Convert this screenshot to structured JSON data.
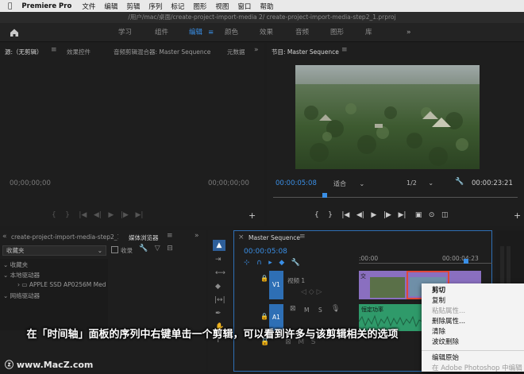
{
  "menubar": {
    "app": "Premiere Pro",
    "items": [
      "文件",
      "编辑",
      "剪辑",
      "序列",
      "标记",
      "图形",
      "视图",
      "窗口",
      "帮助"
    ]
  },
  "window_title": "/用户/mac/桌面/create-project-import-media 2/  create-project-import-media-step2_1.prproj",
  "workspaces": {
    "items": [
      "学习",
      "组件",
      "编辑",
      "颜色",
      "效果",
      "音频",
      "图形",
      "库"
    ],
    "active": "编辑",
    "more": "»"
  },
  "source_panel": {
    "tabs": [
      "源:（无剪辑）",
      "效果控件",
      "音频剪辑混合器: Master Sequence",
      "元数据"
    ],
    "timecode_left": "00;00;00;00",
    "timecode_right": "00;00;00;00"
  },
  "program_panel": {
    "tab": "节目: Master Sequence",
    "timecode_left": "00:00:05:08",
    "fit": "适合",
    "resolution": "1/2",
    "timecode_right": "00:00:23:21"
  },
  "project_panel": {
    "tabs": [
      "create-project-import-media-step2_1",
      "媒体浏览器"
    ],
    "favorites_dropdown": "收藏夹",
    "ingest_label": "收录",
    "tree": [
      "收藏夹",
      "本地驱动器",
      "APPLE SSD AP0256M Med",
      "网络驱动器"
    ]
  },
  "timeline": {
    "tab": "Master Sequence",
    "timecode": "00:00:05:08",
    "ruler": [
      ":00:00",
      "00:00:04:23"
    ],
    "tracks": [
      {
        "id": "V1",
        "name": "视频 1"
      },
      {
        "id": "A1",
        "name": ""
      }
    ],
    "clip_label": "恒定功率",
    "track_buttons": [
      "M",
      "S"
    ]
  },
  "context_menu": {
    "items": [
      {
        "label": "剪切",
        "enabled": true,
        "bold": true
      },
      {
        "label": "复制",
        "enabled": true
      },
      {
        "label": "粘贴属性...",
        "enabled": false
      },
      {
        "label": "删除属性...",
        "enabled": true
      },
      {
        "label": "清除",
        "enabled": true
      },
      {
        "label": "波纹删除",
        "enabled": true
      },
      {
        "label": "编辑原始",
        "enabled": true
      },
      {
        "label": "在 Adobe Photoshop 中编辑",
        "enabled": false
      }
    ]
  },
  "caption": "在「时间轴」面板的序列中右键单击一个剪辑，可以看到许多与该剪辑相关的选项",
  "watermark": "www.MacZ.com",
  "colors": {
    "accent": "#3a8fe6",
    "clip_red_outline": "#e0473a",
    "video_clip": "#8a6fc0",
    "audio_clip": "#2f9a6a"
  }
}
